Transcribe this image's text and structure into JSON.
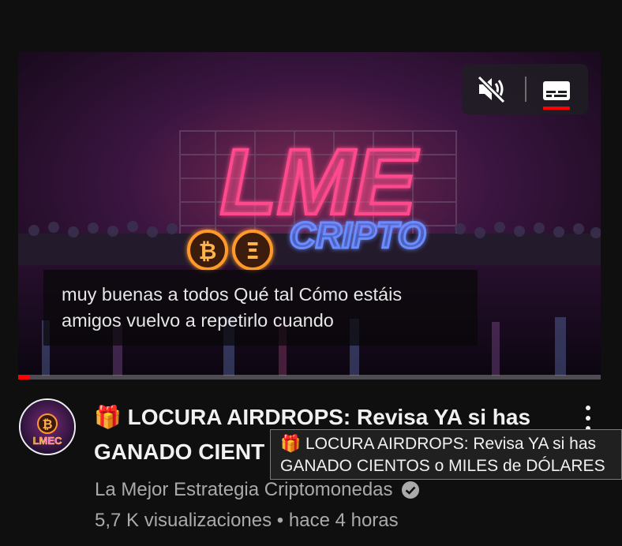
{
  "player": {
    "thumbnail_text": "LME",
    "thumbnail_subtext": "CRIPTO",
    "coin_symbols": [
      "₿",
      "Ξ"
    ],
    "caption_lines": [
      "muy buenas a todos Qué tal Cómo estáis",
      "amigos vuelvo a repetirlo cuando"
    ],
    "mute_icon": "volume-muted-icon",
    "cc_icon": "subtitles-icon",
    "progress_fraction": 0.02,
    "accent_color": "#ff0000"
  },
  "video": {
    "title_emoji": "🎁",
    "title_line1": "LOCURA AIRDROPS: Revisa YA si has",
    "title_line2": "GANADO CIENT",
    "channel_avatar_text": "LMEC",
    "channel_avatar_coin": "₿",
    "channel": "La Mejor Estrategia Criptomonedas",
    "verified_icon": "verified-check-icon",
    "views": "5,7 K visualizaciones",
    "separator": "•",
    "time_ago": "hace 4 horas",
    "menu_icon": "more-vertical-icon"
  },
  "tooltip": {
    "emoji": "🎁",
    "line1": "LOCURA AIRDROPS: Revisa YA si has",
    "line2": "GANADO CIENTOS o MILES de DÓLARES"
  }
}
